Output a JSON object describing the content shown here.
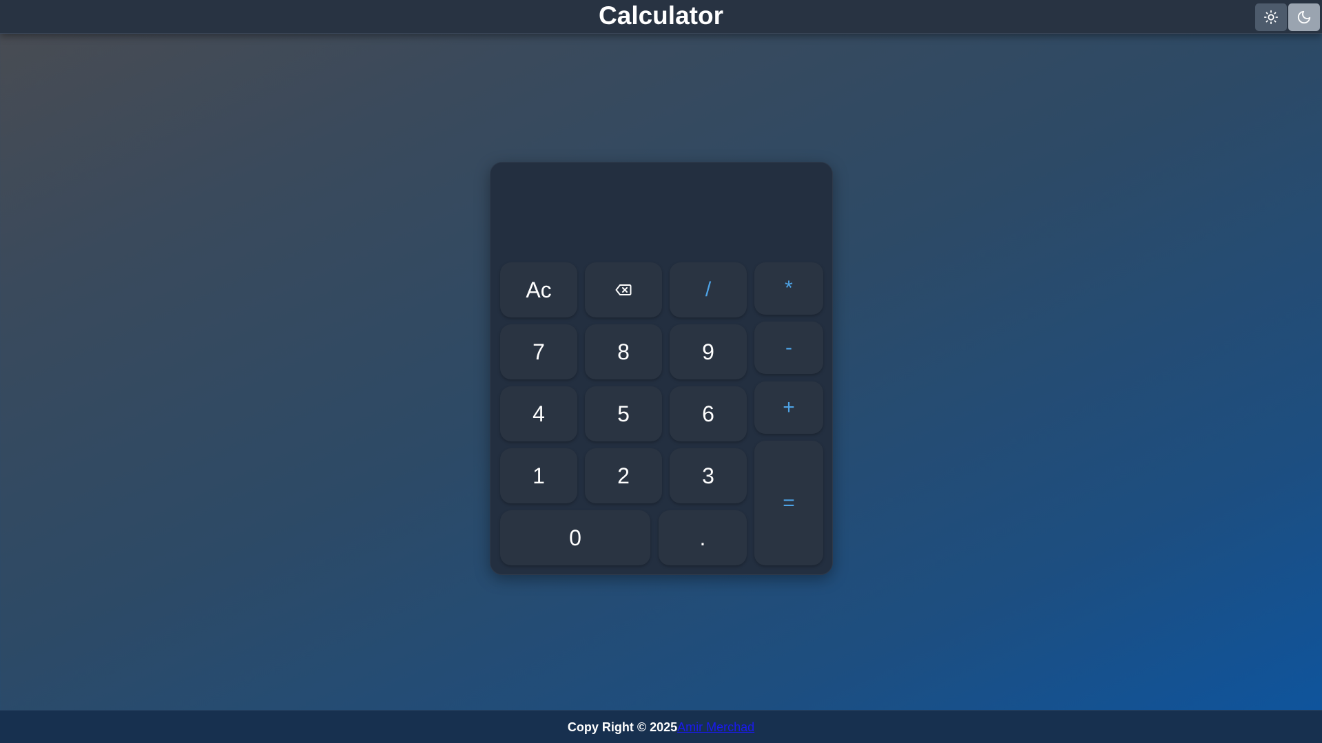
{
  "header": {
    "title": "Calculator",
    "theme_light_icon": "sun-icon",
    "theme_dark_icon": "moon-icon"
  },
  "calculator": {
    "display_value": "",
    "keys": {
      "clear": "Ac",
      "backspace_icon": "backspace-icon",
      "divide": "/",
      "multiply": "*",
      "seven": "7",
      "eight": "8",
      "nine": "9",
      "minus": "-",
      "four": "4",
      "five": "5",
      "six": "6",
      "plus": "+",
      "one": "1",
      "two": "2",
      "three": "3",
      "equals": "=",
      "zero": "0",
      "decimal": "."
    },
    "colors": {
      "operator": "#4ea3e6",
      "key_background": "#2a3442",
      "panel_background": "#232f40"
    }
  },
  "footer": {
    "text": "Copy Right © 2025",
    "author_link": "Amir Merchad"
  }
}
